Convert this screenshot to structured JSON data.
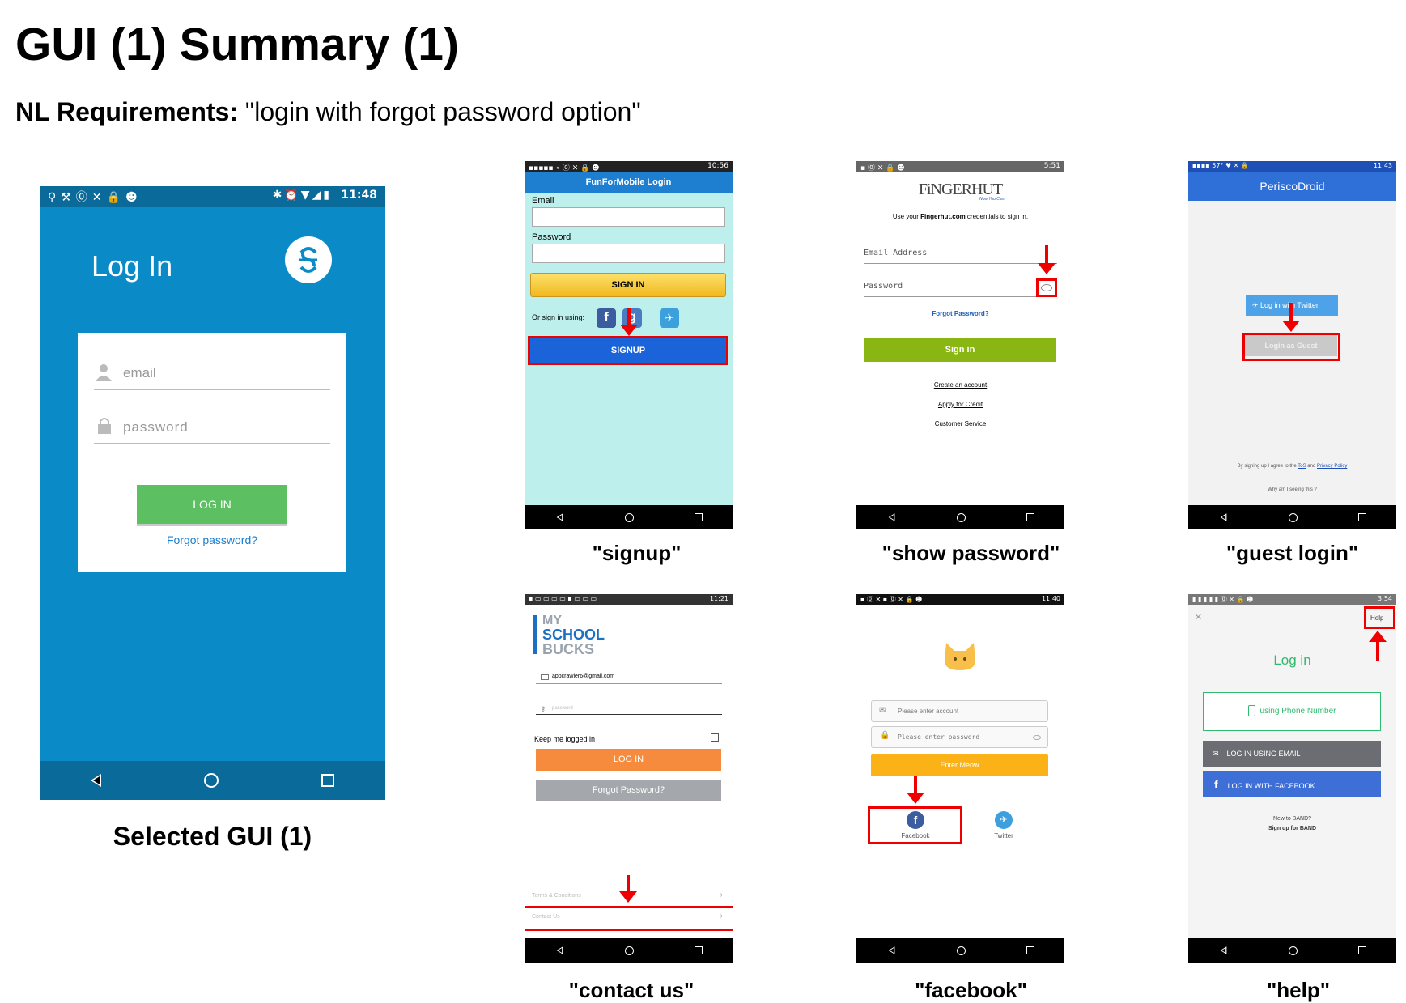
{
  "page": {
    "title": "GUI (1) Summary (1)",
    "nl_prefix": "NL Requirements:",
    "nl_text": "\"login with forgot password option\""
  },
  "selected": {
    "caption": "Selected GUI (1)",
    "status_time": "11:48",
    "title": "Log In",
    "email_placeholder": "email",
    "password_placeholder": "password",
    "login_button": "LOG IN",
    "forgot_link": "Forgot password?",
    "colors": {
      "bg": "#0a8ac7",
      "statusbar": "#0a6a9a",
      "button": "#5cbf62",
      "link": "#1a7fd0"
    }
  },
  "signup": {
    "caption": "\"signup\"",
    "status_time": "10:56",
    "header": "FunForMobile Login",
    "email_label": "Email",
    "password_label": "Password",
    "signin_button": "SIGN IN",
    "or_sign_in": "Or sign in using:",
    "signup_button": "SIGNUP"
  },
  "fingerhut": {
    "caption": "\"show password\"",
    "status_time": "5:51",
    "logo": "FiNGERHUT",
    "tagline": "Now You Can!",
    "intro_pre": "Use your ",
    "intro_bold": "Fingerhut.com",
    "intro_post": " credentials to sign in.",
    "email_placeholder": "Email Address",
    "password_placeholder": "Password",
    "forgot_link": "Forgot Password?",
    "signin_button": "Sign in",
    "links": [
      "Create an account",
      "Apply for Credit",
      "Customer Service"
    ]
  },
  "periscodroid": {
    "caption": "\"guest login\"",
    "status_time": "11:43",
    "status_temp": "57°",
    "header": "PeriscoDroid",
    "twitter_button": "Log in with Twitter",
    "guest_button": "Login as Guest",
    "terms_pre": "By signing up I agree to the ",
    "terms_tos": "ToS",
    "terms_and": " and ",
    "terms_privacy": "Privacy Policy",
    "why": "Why am I seeing this ?"
  },
  "schoolbucks": {
    "caption": "\"contact us\"",
    "status_time": "11:21",
    "logo_lines": [
      "MY",
      "SCHOOL",
      "BUCKS"
    ],
    "email_value": "appcrawler6@gmail.com",
    "password_placeholder": "password",
    "keep_logged": "Keep me logged in",
    "login_button": "LOG IN",
    "forgot_button": "Forgot Password?",
    "terms": "Terms & Conditions",
    "contact": "Contact Us"
  },
  "meow": {
    "caption": "\"facebook\"",
    "status_time": "11:40",
    "account_placeholder": "Please enter account",
    "password_placeholder": "Please enter password",
    "enter_button": "Enter Meow",
    "facebook_label": "Facebook",
    "twitter_label": "Twitter"
  },
  "band": {
    "caption": "\"help\"",
    "status_time": "3:54",
    "help": "Help",
    "title": "Log in",
    "phone_button": "using Phone Number",
    "email_button": "LOG IN USING EMAIL",
    "facebook_button": "LOG IN WITH FACEBOOK",
    "new_to": "New to BAND?",
    "signup_link": "Sign up for BAND"
  }
}
